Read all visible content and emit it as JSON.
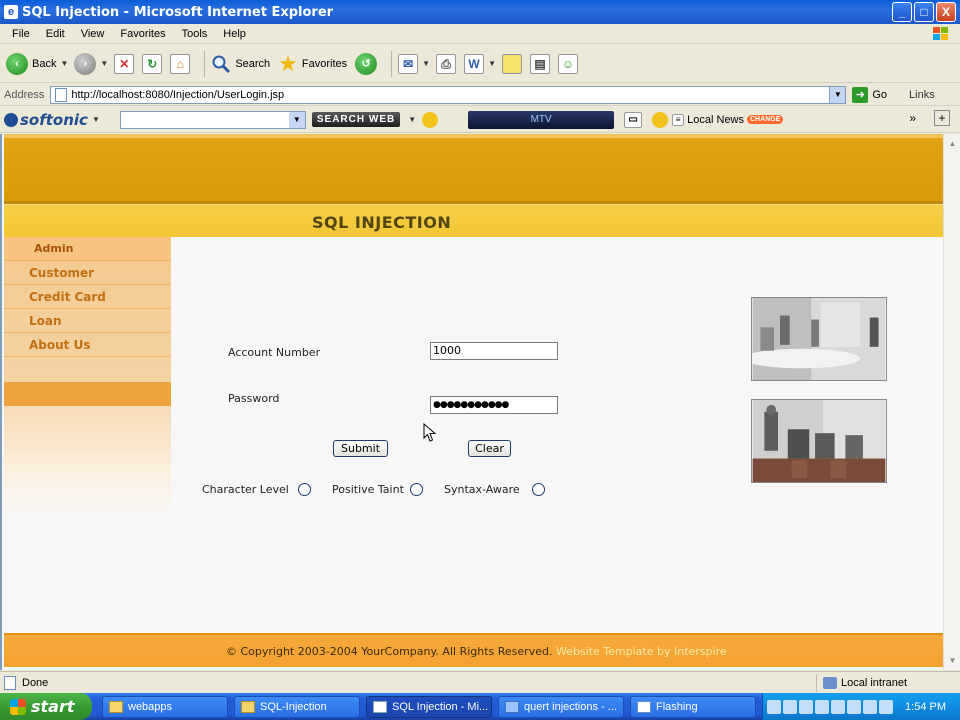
{
  "window": {
    "title": "SQL Injection - Microsoft Internet Explorer",
    "controls": [
      "_",
      "□",
      "X"
    ]
  },
  "menu": [
    "File",
    "Edit",
    "View",
    "Favorites",
    "Tools",
    "Help"
  ],
  "toolbar": {
    "back_label": "Back",
    "search_label": "Search",
    "favorites_label": "Favorites"
  },
  "address": {
    "label": "Address",
    "url": "http://localhost:8080/Injection/UserLogin.jsp",
    "go_label": "Go",
    "links_label": "Links"
  },
  "softonic": {
    "brand": "softonic",
    "search_web_label": "SEARCH WEB",
    "media_label": "MTV",
    "local_news_label": "Local News",
    "change_badge": "CHANGE"
  },
  "site": {
    "title": "SQL INJECTION",
    "sidebar": [
      {
        "label": "Admin"
      },
      {
        "label": "Customer"
      },
      {
        "label": "Credit Card"
      },
      {
        "label": "Loan"
      },
      {
        "label": "About Us"
      }
    ],
    "form": {
      "account_label": "Account Number",
      "account_value": "1000",
      "password_label": "Password",
      "password_value": "●●●●●●●●●●●",
      "submit_label": "Submit",
      "clear_label": "Clear"
    },
    "options": [
      {
        "label": "Character Level",
        "selected": false
      },
      {
        "label": "Positive Taint",
        "selected": false
      },
      {
        "label": "Syntax-Aware",
        "selected": false
      }
    ],
    "footer": {
      "copyright": "© Copyright 2003-2004 YourCompany. All Rights Reserved.",
      "credit": " Website Template by Interspire"
    }
  },
  "status": {
    "text": "Done",
    "zone": "Local intranet"
  },
  "taskbar": {
    "start_label": "start",
    "tasks": [
      {
        "label": "webapps",
        "active": false
      },
      {
        "label": "SQL-Injection",
        "active": false
      },
      {
        "label": "SQL Injection - Mi...",
        "active": true
      },
      {
        "label": "quert injections - ...",
        "active": false
      },
      {
        "label": "Flashing",
        "active": false
      }
    ],
    "clock": "1:54 PM"
  },
  "colors": {
    "header_gold": "#d89a07",
    "title_band": "#f2c531",
    "sidebar_link": "#c46f12",
    "footer_orange": "#f3a230",
    "xp_blue": "#245edb"
  }
}
